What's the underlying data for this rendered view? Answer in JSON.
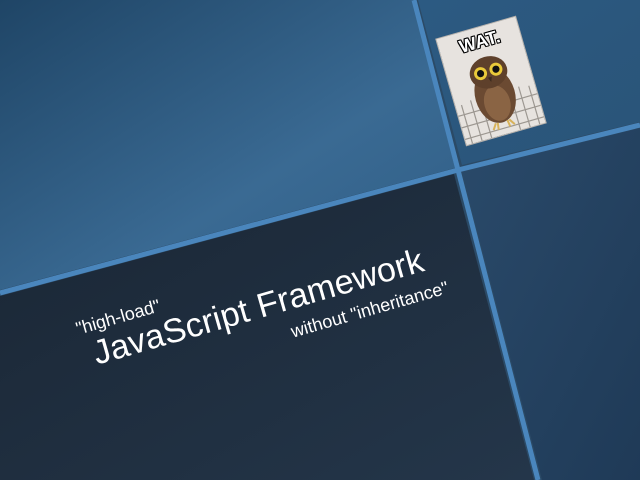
{
  "slide": {
    "subtitle_top": "\"high-load\"",
    "title": "JavaScript Framework",
    "subtitle_bottom": "without \"inheritance\""
  },
  "photo": {
    "caption": "WAT.",
    "subject": "owl-photo"
  },
  "colors": {
    "top_left_panel": "#2f5a80",
    "bottom_panel": "#1f2d3d",
    "right_panel": "#243a55",
    "divider": "#4a83b8",
    "text": "#ffffff"
  }
}
